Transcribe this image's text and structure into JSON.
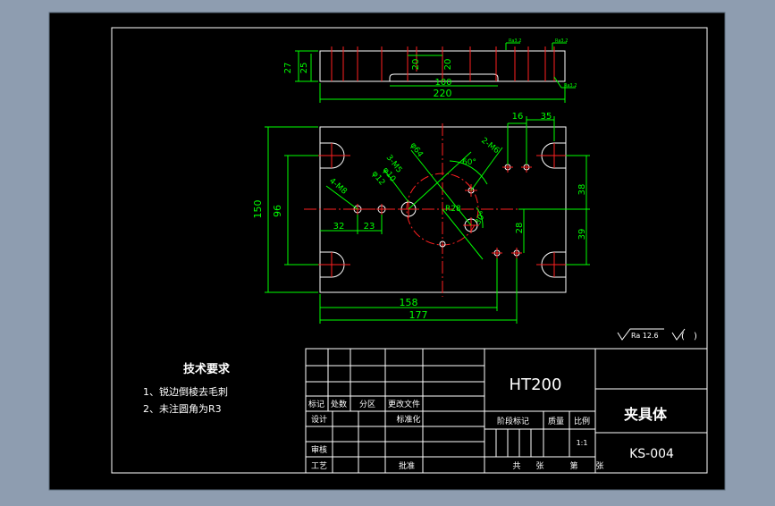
{
  "viewport": {
    "background": "#8e9db0",
    "paper": "#000000"
  },
  "colors": {
    "part_line": "#ffffff",
    "dimension": "#00ff00",
    "center_line": "#ff2020",
    "border": "#ffffff",
    "annotation": "#00ff00"
  },
  "top_view": {
    "dims": {
      "height_27": "27",
      "height_25": "25",
      "width_220": "220",
      "slot_100": "100",
      "pitch_20a": "20",
      "pitch_20b": "20"
    },
    "surface_marks": [
      "Ra3.2",
      "Ra3.2",
      "Ra3.2"
    ]
  },
  "plan_view": {
    "dims": {
      "total_height": "150",
      "slot_pitch": "96",
      "d_16": "16",
      "d_35": "35",
      "d_38": "38",
      "d_39": "39",
      "d_28": "28",
      "d_32": "32",
      "d_23": "23",
      "d_158": "158",
      "d_177": "177"
    },
    "callouts": {
      "dia64": "φ64",
      "three_m5": "3-M5",
      "dia12": "φ12",
      "dia10": "φ10",
      "four_m8": "4-M8",
      "two_m6": "2-M6",
      "ang60": "60°",
      "ang30": "30°",
      "r28": "R28"
    }
  },
  "roughness_note": {
    "value": "Ra 12.6",
    "suffix": "(",
    "suffix_close": ")"
  },
  "tech_requirements": {
    "title": "技术要求",
    "items": [
      "1、锐边倒棱去毛刺",
      "2、未注圆角为R3"
    ]
  },
  "title_block": {
    "material": "HT200",
    "part_name": "夹具体",
    "drawing_no": "KS-004",
    "row_headers": [
      "标记",
      "处数",
      "分区",
      "更改文件"
    ],
    "design": "设计",
    "standardize": "标准化",
    "review": "审核",
    "process": "工艺",
    "approve": "批准",
    "stage_mark": "阶段标记",
    "weight": "质量",
    "scale": "比例",
    "scale_value": "1:1",
    "total": "共",
    "sheets": "张",
    "sheet_no": "第",
    "sheet_unit": "张"
  }
}
